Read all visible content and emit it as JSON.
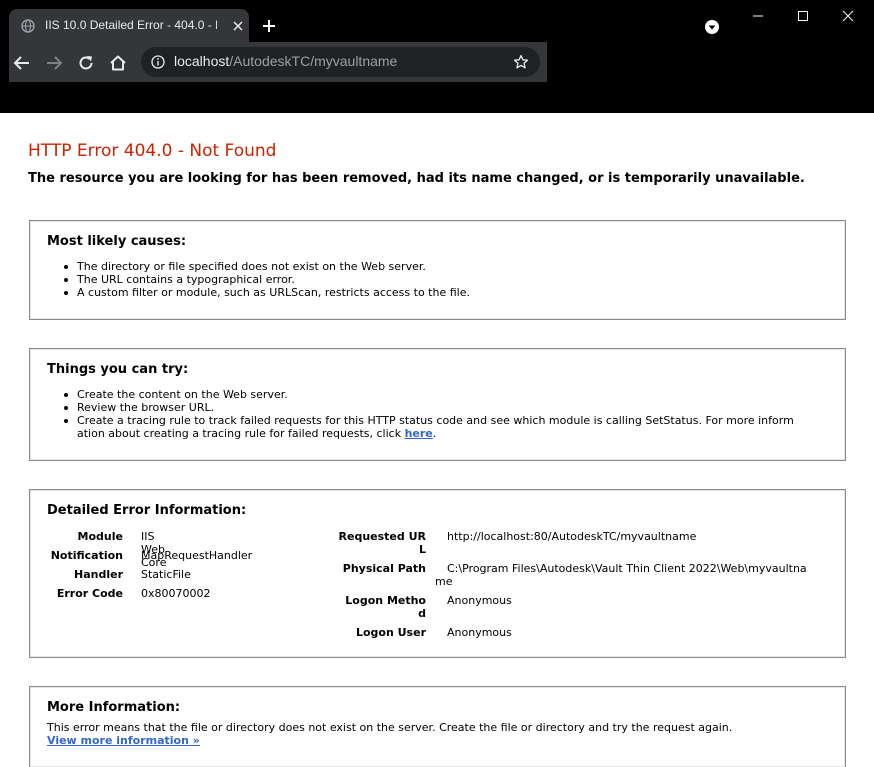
{
  "browser": {
    "tab_title": "IIS 10.0 Detailed Error - 404.0 - N",
    "url_host": "localhost",
    "url_path": "/AutodeskTC/myvaultname",
    "icons": [
      "globe-icon",
      "close-icon",
      "plus-icon",
      "profile-dropdown-icon",
      "minimize-icon",
      "maximize-icon",
      "close-icon",
      "back-icon",
      "forward-icon",
      "reload-icon",
      "home-icon",
      "info-icon",
      "star-icon"
    ]
  },
  "page": {
    "title": "HTTP Error 404.0 - Not Found",
    "subtitle": "The resource you are looking for has been removed, had its name changed, or is temporarily unavailable.",
    "causes": {
      "heading": "Most likely causes:",
      "items": [
        "The directory or file specified does not exist on the Web server.",
        "The URL contains a typographical error.",
        "A custom filter or module, such as URLScan, restricts access to the file."
      ]
    },
    "try": {
      "heading": "Things you can try:",
      "items": [
        "Create the content on the Web server.",
        "Review the browser URL."
      ],
      "item3_line1": "Create a tracing rule to track failed requests for this HTTP status code and see which module is calling SetStatus. For more inform",
      "item3_line2": "ation about creating a tracing rule for failed requests, click ",
      "item3_link": "here",
      "item3_end": "."
    },
    "detail": {
      "heading": "Detailed Error Information:",
      "module_label": "Module",
      "module_value": "IIS Web Core",
      "notification_label": "Notification",
      "notification_value": "MapRequestHandler",
      "handler_label": "Handler",
      "handler_value": "StaticFile",
      "error_code_label": "Error Code",
      "error_code_value": "0x80070002",
      "requested_url_label_1": "Requested UR",
      "requested_url_label_2": "L",
      "requested_url_value": "http://localhost:80/AutodeskTC/myvaultname",
      "physical_path_label": "Physical Path",
      "physical_path_value_1": "C:\\Program Files\\Autodesk\\Vault Thin Client 2022\\Web\\myvaultna",
      "physical_path_value_2": "me",
      "logon_method_label_1": "Logon Metho",
      "logon_method_label_2": "d",
      "logon_method_value": "Anonymous",
      "logon_user_label": "Logon User",
      "logon_user_value": "Anonymous"
    },
    "more": {
      "heading": "More Information:",
      "text": "This error means that the file or directory does not exist on the server. Create the file or directory and try the request again.",
      "link": "View more information »"
    }
  }
}
